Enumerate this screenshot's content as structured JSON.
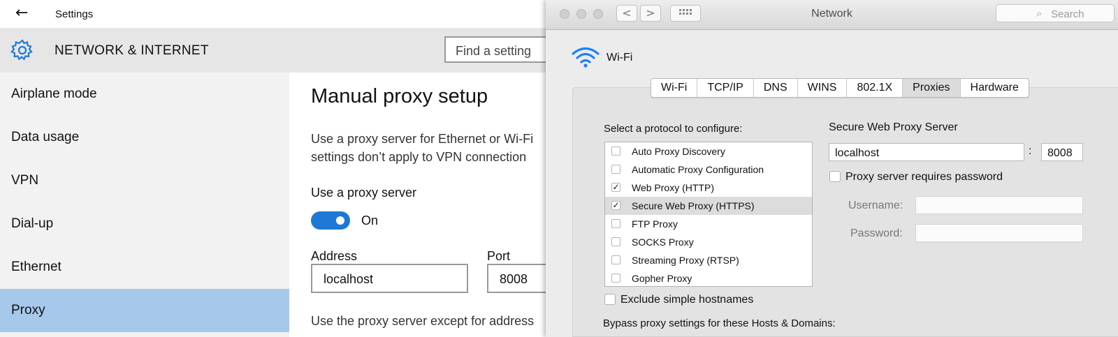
{
  "windows": {
    "app_title": "Settings",
    "section_title": "NETWORK & INTERNET",
    "search_placeholder": "Find a setting",
    "nav": [
      {
        "label": "Airplane mode"
      },
      {
        "label": "Data usage"
      },
      {
        "label": "VPN"
      },
      {
        "label": "Dial-up"
      },
      {
        "label": "Ethernet"
      },
      {
        "label": "Proxy",
        "selected": true
      }
    ],
    "page_title": "Manual proxy setup",
    "description_line1": "Use a proxy server for Ethernet or Wi-Fi",
    "description_line2": "settings don’t apply to VPN connection",
    "use_proxy_label": "Use a proxy server",
    "toggle_state": "On",
    "address_label": "Address",
    "address_value": "localhost",
    "port_label": "Port",
    "port_value": "8008",
    "except_text": "Use the proxy server except for address",
    "accent_color": "#1e78d7",
    "selected_nav_color": "#a6c8ea"
  },
  "mac": {
    "window_title": "Network",
    "search_placeholder": "Search",
    "interface_name": "Wi-Fi",
    "tabs": [
      {
        "label": "Wi-Fi"
      },
      {
        "label": "TCP/IP"
      },
      {
        "label": "DNS"
      },
      {
        "label": "WINS"
      },
      {
        "label": "802.1X"
      },
      {
        "label": "Proxies",
        "active": true
      },
      {
        "label": "Hardware"
      }
    ],
    "protocol_label": "Select a protocol to configure:",
    "protocols": [
      {
        "label": "Auto Proxy Discovery",
        "checked": false
      },
      {
        "label": "Automatic Proxy Configuration",
        "checked": false
      },
      {
        "label": "Web Proxy (HTTP)",
        "checked": true
      },
      {
        "label": "Secure Web Proxy (HTTPS)",
        "checked": true,
        "selected": true
      },
      {
        "label": "FTP Proxy",
        "checked": false
      },
      {
        "label": "SOCKS Proxy",
        "checked": false
      },
      {
        "label": "Streaming Proxy (RTSP)",
        "checked": false
      },
      {
        "label": "Gopher Proxy",
        "checked": false
      }
    ],
    "server_title": "Secure Web Proxy Server",
    "server_host": "localhost",
    "server_colon": ":",
    "server_port": "8008",
    "requires_password_label": "Proxy server requires password",
    "username_label": "Username:",
    "password_label": "Password:",
    "exclude_label": "Exclude simple hostnames",
    "bypass_label": "Bypass proxy settings for these Hosts & Domains:",
    "check_glyph": "✓",
    "back_glyph": "<",
    "forward_glyph": ">",
    "wifi_color": "#1a82fb"
  }
}
